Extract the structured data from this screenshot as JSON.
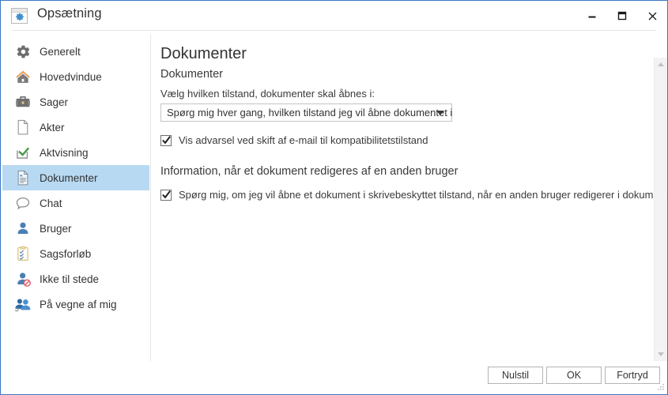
{
  "window": {
    "title": "Opsætning",
    "app_icon": "settings-window-icon",
    "border_color": "#3b78c3",
    "controls": {
      "minimize": "minimize-icon",
      "maximize": "maximize-icon",
      "close": "close-icon"
    }
  },
  "sidebar": {
    "selected_index": 5,
    "selected_bg": "#b8d9f2",
    "items": [
      {
        "label": "Generelt",
        "icon": "gear-icon"
      },
      {
        "label": "Hovedvindue",
        "icon": "home-icon"
      },
      {
        "label": "Sager",
        "icon": "briefcase-icon"
      },
      {
        "label": "Akter",
        "icon": "page-icon"
      },
      {
        "label": "Aktvisning",
        "icon": "check-box-icon"
      },
      {
        "label": "Dokumenter",
        "icon": "document-icon"
      },
      {
        "label": "Chat",
        "icon": "speech-bubble-icon"
      },
      {
        "label": "Bruger",
        "icon": "user-icon"
      },
      {
        "label": "Sagsforløb",
        "icon": "clipboard-check-icon"
      },
      {
        "label": "Ikke til stede",
        "icon": "user-blocked-icon"
      },
      {
        "label": "På vegne af mig",
        "icon": "users-delegate-icon"
      }
    ]
  },
  "main": {
    "page_title": "Dokumenter",
    "section_title": "Dokumenter",
    "field_label": "Vælg hvilken tilstand, dokumenter skal åbnes i:",
    "combo": {
      "value": "Spørg mig hver gang, hvilken tilstand jeg vil åbne dokumentet i",
      "arrow_icon": "chevron-down-icon"
    },
    "checkbox_warning": {
      "label": "Vis advarsel ved skift af e-mail til kompatibilitetstilstand",
      "checked": true
    },
    "subsection_title": "Information, når et dokument redigeres af en anden bruger",
    "checkbox_readonly": {
      "label": "Spørg mig, om jeg vil åbne et dokument i skrivebeskyttet tilstand, når en anden bruger redigerer i dokumentet",
      "checked": true
    },
    "scrollbar": {
      "up_icon": "scroll-up-arrow-icon",
      "down_icon": "scroll-down-arrow-icon"
    }
  },
  "footer": {
    "reset_label": "Nulstil",
    "ok_label": "OK",
    "cancel_label": "Fortryd",
    "grip_icon": "resize-grip-icon"
  }
}
